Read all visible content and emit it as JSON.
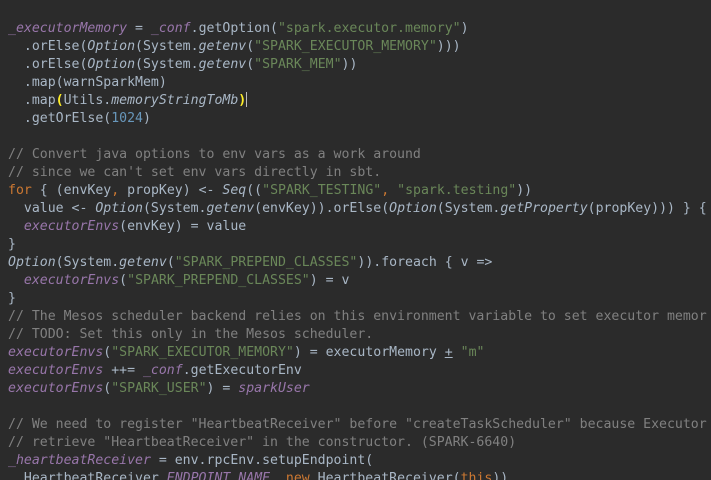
{
  "lines": [
    [
      {
        "t": "_executorMemory",
        "c": "field"
      },
      {
        "t": " = ",
        "c": "ident"
      },
      {
        "t": "_conf",
        "c": "field"
      },
      {
        "t": ".getOption(",
        "c": "ident"
      },
      {
        "t": "\"spark.executor.memory\"",
        "c": "string"
      },
      {
        "t": ")",
        "c": "ident"
      }
    ],
    [
      {
        "t": "  .orElse(",
        "c": "ident"
      },
      {
        "t": "Option",
        "c": "ital"
      },
      {
        "t": "(System.",
        "c": "ident"
      },
      {
        "t": "getenv",
        "c": "ital"
      },
      {
        "t": "(",
        "c": "ident"
      },
      {
        "t": "\"SPARK_EXECUTOR_MEMORY\"",
        "c": "string"
      },
      {
        "t": ")))",
        "c": "ident"
      }
    ],
    [
      {
        "t": "  .orElse(",
        "c": "ident"
      },
      {
        "t": "Option",
        "c": "ital"
      },
      {
        "t": "(System.",
        "c": "ident"
      },
      {
        "t": "getenv",
        "c": "ital"
      },
      {
        "t": "(",
        "c": "ident"
      },
      {
        "t": "\"SPARK_MEM\"",
        "c": "string"
      },
      {
        "t": "))",
        "c": "ident"
      }
    ],
    [
      {
        "t": "  .map(warnSparkMem)",
        "c": "ident"
      }
    ],
    [
      {
        "t": "  .map",
        "c": "ident"
      },
      {
        "t": "(",
        "c": "brace-hl"
      },
      {
        "t": "Utils.",
        "c": "ident"
      },
      {
        "t": "memoryStringToMb",
        "c": "ital"
      },
      {
        "t": ")",
        "c": "brace-hl"
      },
      {
        "t": "",
        "c": "caret"
      }
    ],
    [
      {
        "t": "  .getOrElse(",
        "c": "ident"
      },
      {
        "t": "1024",
        "c": "num"
      },
      {
        "t": ")",
        "c": "ident"
      }
    ],
    [],
    [
      {
        "t": "// Convert java options to env vars as a work around",
        "c": "comment"
      }
    ],
    [
      {
        "t": "// since we can't set env vars directly in sbt.",
        "c": "comment"
      }
    ],
    [
      {
        "t": "for",
        "c": "kw"
      },
      {
        "t": " { (envKey",
        "c": "ident"
      },
      {
        "t": ",",
        "c": "kw"
      },
      {
        "t": " propKey) <- ",
        "c": "ident"
      },
      {
        "t": "Seq",
        "c": "ital"
      },
      {
        "t": "((",
        "c": "ident"
      },
      {
        "t": "\"SPARK_TESTING\"",
        "c": "string"
      },
      {
        "t": ",",
        "c": "kw"
      },
      {
        "t": " ",
        "c": "ident"
      },
      {
        "t": "\"spark.testing\"",
        "c": "string"
      },
      {
        "t": "))",
        "c": "ident"
      }
    ],
    [
      {
        "t": "  value <- ",
        "c": "ident"
      },
      {
        "t": "Option",
        "c": "ital"
      },
      {
        "t": "(System.",
        "c": "ident"
      },
      {
        "t": "getenv",
        "c": "ital"
      },
      {
        "t": "(envKey)).orElse(",
        "c": "ident"
      },
      {
        "t": "Option",
        "c": "ital"
      },
      {
        "t": "(System.",
        "c": "ident"
      },
      {
        "t": "getProperty",
        "c": "ital"
      },
      {
        "t": "(propKey))) } {",
        "c": "ident"
      }
    ],
    [
      {
        "t": "  ",
        "c": "ident"
      },
      {
        "t": "executorEnvs",
        "c": "field"
      },
      {
        "t": "(envKey) = value",
        "c": "ident"
      }
    ],
    [
      {
        "t": "}",
        "c": "ident"
      }
    ],
    [
      {
        "t": "Option",
        "c": "ital"
      },
      {
        "t": "(System.",
        "c": "ident"
      },
      {
        "t": "getenv",
        "c": "ital"
      },
      {
        "t": "(",
        "c": "ident"
      },
      {
        "t": "\"SPARK_PREPEND_CLASSES\"",
        "c": "string"
      },
      {
        "t": ")).foreach { v =>",
        "c": "ident"
      }
    ],
    [
      {
        "t": "  ",
        "c": "ident"
      },
      {
        "t": "executorEnvs",
        "c": "field"
      },
      {
        "t": "(",
        "c": "ident"
      },
      {
        "t": "\"SPARK_PREPEND_CLASSES\"",
        "c": "string"
      },
      {
        "t": ") = v",
        "c": "ident"
      }
    ],
    [
      {
        "t": "}",
        "c": "ident"
      }
    ],
    [
      {
        "t": "// The Mesos scheduler backend relies on this environment variable to set executor memor",
        "c": "comment"
      }
    ],
    [
      {
        "t": "// TODO: Set this only in the Mesos scheduler.",
        "c": "comment"
      }
    ],
    [
      {
        "t": "executorEnvs",
        "c": "field"
      },
      {
        "t": "(",
        "c": "ident"
      },
      {
        "t": "\"SPARK_EXECUTOR_MEMORY\"",
        "c": "string"
      },
      {
        "t": ") = executorMemory ",
        "c": "ident"
      },
      {
        "t": "+",
        "c": "underline"
      },
      {
        "t": " ",
        "c": "ident"
      },
      {
        "t": "\"m\"",
        "c": "string"
      }
    ],
    [
      {
        "t": "executorEnvs",
        "c": "field"
      },
      {
        "t": " ++= ",
        "c": "ident"
      },
      {
        "t": "_conf",
        "c": "field"
      },
      {
        "t": ".getExecutorEnv",
        "c": "ident"
      }
    ],
    [
      {
        "t": "executorEnvs",
        "c": "field"
      },
      {
        "t": "(",
        "c": "ident"
      },
      {
        "t": "\"SPARK_USER\"",
        "c": "string"
      },
      {
        "t": ") = ",
        "c": "ident"
      },
      {
        "t": "sparkUser",
        "c": "field"
      }
    ],
    [],
    [
      {
        "t": "// We need to register \"HeartbeatReceiver\" before \"createTaskScheduler\" because Executor",
        "c": "comment"
      }
    ],
    [
      {
        "t": "// retrieve \"HeartbeatReceiver\" in the constructor. (SPARK-6640)",
        "c": "comment"
      }
    ],
    [
      {
        "t": "_heartbeatReceiver",
        "c": "field"
      },
      {
        "t": " = env.rpcEnv.setupEndpoint(",
        "c": "ident"
      }
    ],
    [
      {
        "t": "  HeartbeatReceiver.",
        "c": "ident"
      },
      {
        "t": "ENDPOINT_NAME",
        "c": "field"
      },
      {
        "t": ", ",
        "c": "kw"
      },
      {
        "t": "new",
        "c": "kw"
      },
      {
        "t": " HeartbeatReceiver(",
        "c": "ident"
      },
      {
        "t": "this",
        "c": "kw"
      },
      {
        "t": "))",
        "c": "ident"
      }
    ]
  ]
}
